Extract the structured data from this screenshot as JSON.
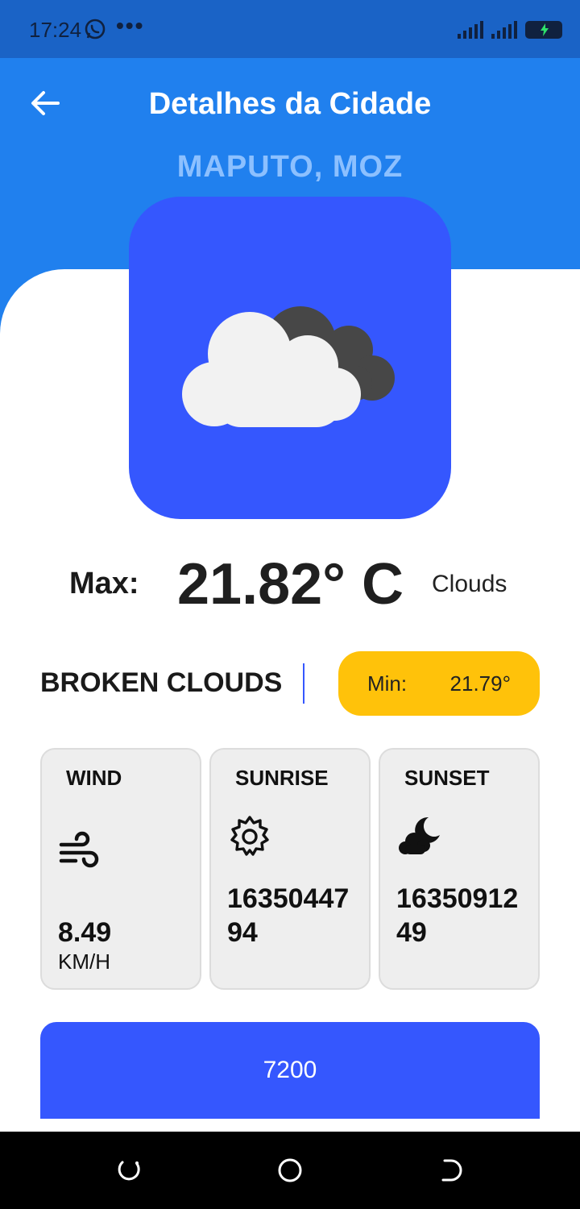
{
  "status_bar": {
    "time": "17:24",
    "dots": "•••",
    "icons": [
      "whatsapp-icon",
      "signal-icon",
      "signal-icon",
      "battery-charging-icon"
    ]
  },
  "header": {
    "title": "Detalhes da Cidade",
    "city": "MAPUTO, MOZ",
    "back_icon": "arrow-left-icon"
  },
  "weather": {
    "icon": "broken-clouds-icon",
    "max_label": "Max:",
    "max_temp": "21.82° C",
    "main": "Clouds",
    "description": "BROKEN CLOUDS",
    "min_label": "Min:",
    "min_temp": "21.79°"
  },
  "cards": {
    "wind": {
      "label": "WIND",
      "icon": "wind-icon",
      "value": "8.49",
      "unit": "KM/H"
    },
    "sunrise": {
      "label": "SUNRISE",
      "icon": "sun-icon",
      "value": "1635044794"
    },
    "sunset": {
      "label": "SUNSET",
      "icon": "cloud-moon-icon",
      "value": "1635091249"
    }
  },
  "bottom_button": {
    "label": "7200"
  },
  "nav": {
    "icons": [
      "recent-apps-icon",
      "home-icon",
      "back-icon"
    ]
  },
  "colors": {
    "header": "#2080ee",
    "status_bar": "#1a63c6",
    "accent": "#3557fe",
    "min_pill": "#ffc20a",
    "card_bg": "#eeeeee"
  }
}
